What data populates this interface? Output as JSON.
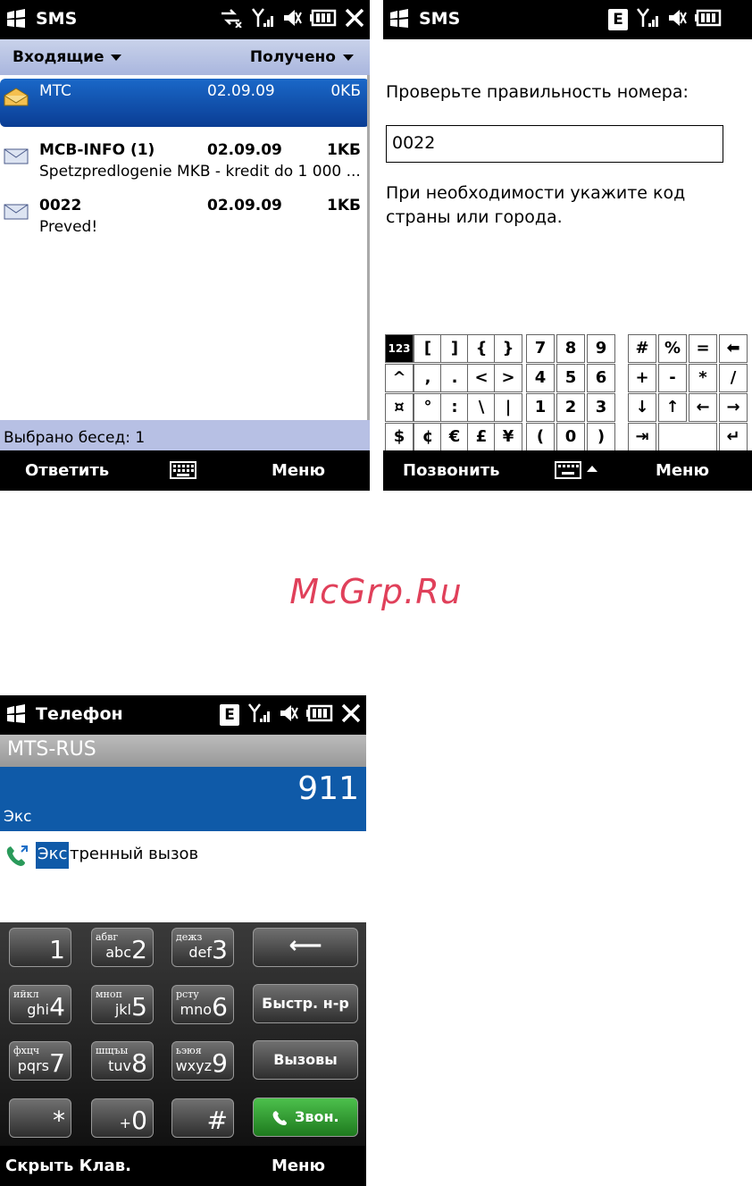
{
  "watermark": "McGrp.Ru",
  "sms_list": {
    "app_title": "SMS",
    "folder": "Входящие",
    "sort": "Получено",
    "messages": [
      {
        "sender": "MTC",
        "date": "02.09.09",
        "size": "0KБ",
        "preview": "",
        "selected": true
      },
      {
        "sender": "MCB-INFO (1)",
        "date": "02.09.09",
        "size": "1KБ",
        "preview": "Spetzpredlogenie  MKB -  kredit do 1 000 ..."
      },
      {
        "sender": "0022",
        "date": "02.09.09",
        "size": "1KБ",
        "preview": "Preved!"
      }
    ],
    "status_text": "Выбрано бесед: 1",
    "soft_left": "Ответить",
    "soft_right": "Меню"
  },
  "sms_confirm": {
    "app_title": "SMS",
    "network_badge": "E",
    "prompt": "Проверьте правильность номера:",
    "number_value": "0022",
    "hint_line1": "При необходимости укажите код",
    "hint_line2": "страны или города.",
    "keyboard_rows": [
      [
        "123",
        "[",
        "]",
        "{",
        "}",
        "7",
        "8",
        "9",
        "#",
        "%",
        "=",
        "⬅"
      ],
      [
        "^",
        ",",
        ".",
        "<",
        ">",
        "4",
        "5",
        "6",
        "+",
        "-",
        "*",
        "/"
      ],
      [
        "¤",
        "°",
        ":",
        "\\",
        "|",
        "1",
        "2",
        "3",
        "↓",
        "↑",
        "←",
        "→"
      ],
      [
        "$",
        "¢",
        "€",
        "£",
        "¥",
        "(",
        "0",
        ")",
        "⇥",
        "",
        "↵"
      ]
    ],
    "soft_left": "Позвонить",
    "soft_right": "Меню"
  },
  "phone": {
    "app_title": "Телефон",
    "network_badge": "E",
    "carrier": "MTS-RUS",
    "dialed_number": "911",
    "typed_letters": "Экс",
    "suggestion_highlight": "Экс",
    "suggestion_rest": "тренный вызов",
    "keys": [
      {
        "digit": "1",
        "cyr": "",
        "lat": ""
      },
      {
        "digit": "2",
        "cyr": "абвг",
        "lat": "abc"
      },
      {
        "digit": "3",
        "cyr": "дежз",
        "lat": "def"
      },
      {
        "digit": "4",
        "cyr": "ийкл",
        "lat": "ghi"
      },
      {
        "digit": "5",
        "cyr": "мноп",
        "lat": "jkl"
      },
      {
        "digit": "6",
        "cyr": "рсту",
        "lat": "mno"
      },
      {
        "digit": "7",
        "cyr": "фхцч",
        "lat": "pqrs"
      },
      {
        "digit": "8",
        "cyr": "шщъы",
        "lat": "tuv"
      },
      {
        "digit": "9",
        "cyr": "ьэюя",
        "lat": "wxyz"
      },
      {
        "digit": "*",
        "cyr": "",
        "lat": ""
      },
      {
        "digit": "0",
        "cyr": "",
        "lat": "+"
      },
      {
        "digit": "#",
        "cyr": "",
        "lat": ""
      }
    ],
    "backspace_label": "⟵",
    "speed_dial_label": "Быстр. н-р",
    "calls_label": "Вызовы",
    "talk_label": "Звон.",
    "soft_left": "Скрыть Клав.",
    "soft_right": "Меню"
  }
}
